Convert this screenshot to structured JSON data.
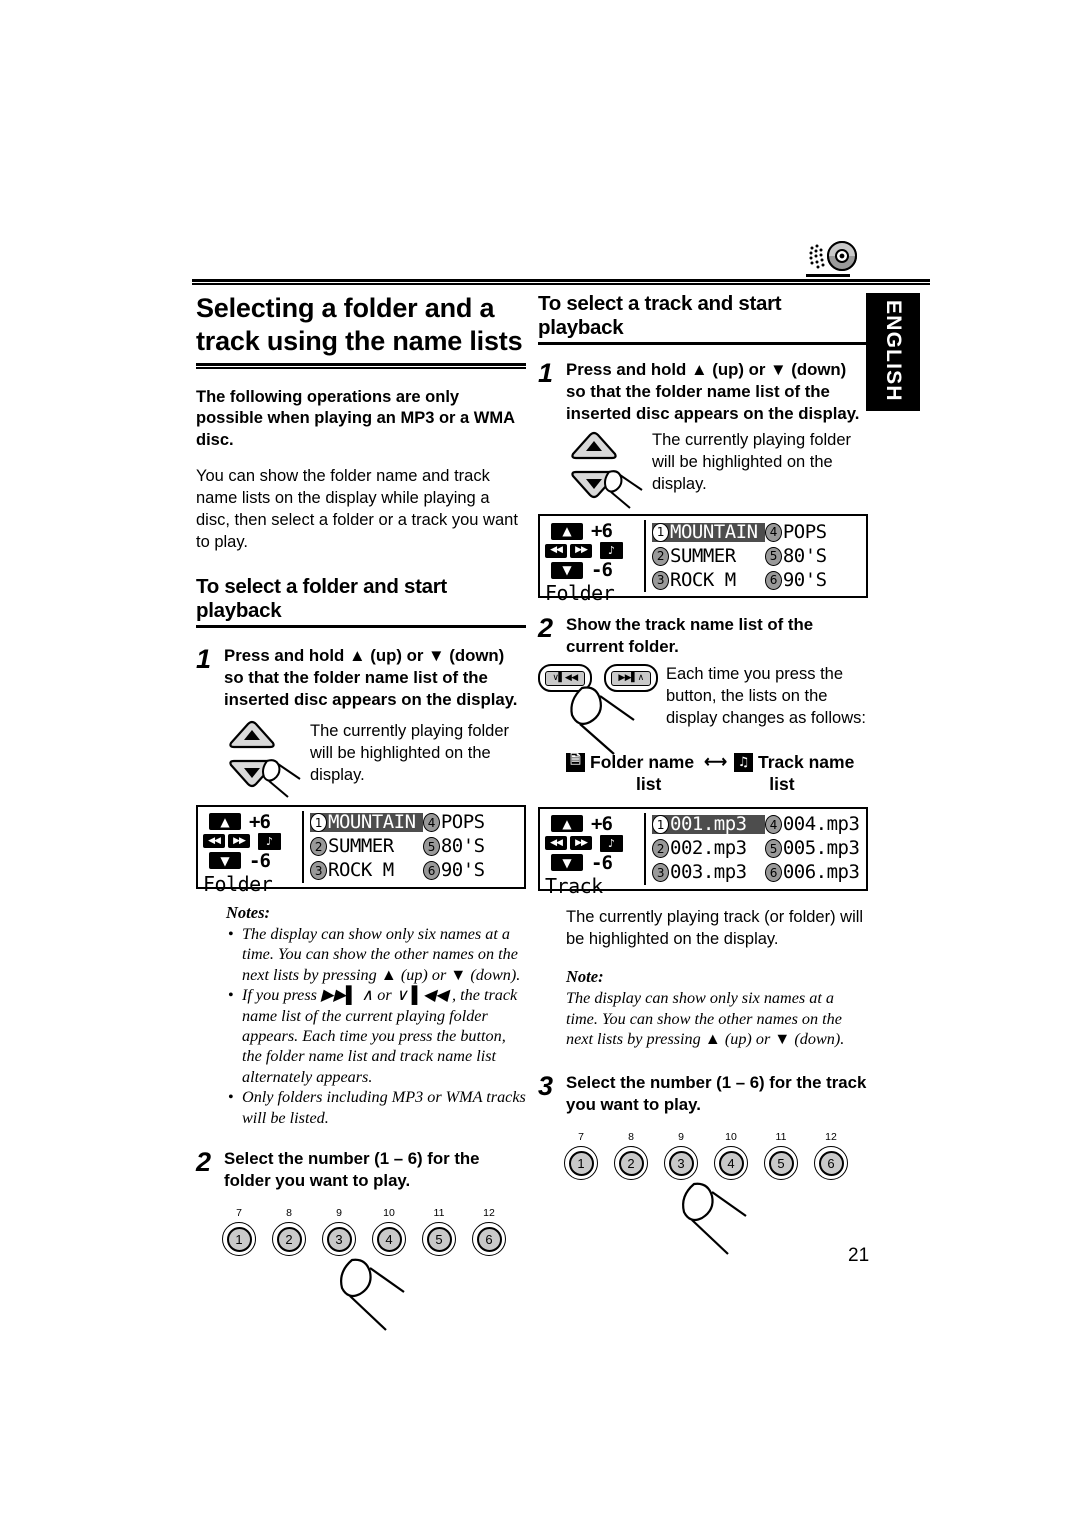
{
  "page": {
    "number": "21",
    "language_tab": "ENGLISH",
    "disc_icon": "compact-disc-icon"
  },
  "left_column": {
    "main_title": "Selecting a folder and a track using the name lists",
    "bold_lead": "The following operations are only possible when playing an MP3 or a WMA disc.",
    "intro_body": "You can show the folder name and track name lists on the display while playing a disc, then select a folder or a track you want to play.",
    "section_title": "To select a folder and start playback",
    "step1": {
      "number": "1",
      "text": "Press and hold ▲ (up) or ▼ (down) so that the folder name list of the inserted disc appears on the display.",
      "sub_note": "The currently playing folder will be highlighted on the display.",
      "button_up": "up-triangle-button",
      "button_down": "down-triangle-button"
    },
    "notes_heading": "Notes:",
    "notes": [
      "The display can show only six names at a time. You can show the other names on the next lists by pressing ▲ (up) or ▼ (down).",
      "If you press ▶▶▌ ∧ or ∨ ▌◀◀ , the track name list of the current playing folder appears. Each time you press the button, the folder name list and track name list alternately appears.",
      "Only folders including MP3 or WMA tracks will be listed."
    ],
    "step2": {
      "number": "2",
      "text": "Select the number (1 – 6) for the folder you want to play."
    }
  },
  "right_column": {
    "section_title": "To select a track and start playback",
    "step1": {
      "number": "1",
      "text": "Press and hold ▲ (up) or ▼ (down)  so that the folder name list of the inserted disc appears on the display.",
      "sub_note": "The currently playing folder will be highlighted on the display."
    },
    "step2": {
      "number": "2",
      "text": "Show the track name list of the current folder.",
      "sub_note": "Each time you press the button, the lists on the display changes as follows:",
      "button_left": "∨▌◀◀",
      "button_right": "▶▶▌∧",
      "folder_label_line1": "Folder name",
      "folder_label_line2": "list",
      "track_label_line1": "Track name",
      "track_label_line2": "list",
      "arrow": "←→"
    },
    "after_track_lcd_note": "The currently playing track (or folder) will be highlighted on the display.",
    "note_heading": "Note:",
    "note_body": "The display can show only six names at a time. You can show the other names on the next lists by pressing ▲ (up) or ▼ (down).",
    "step3": {
      "number": "3",
      "text": "Select the number (1 – 6) for the track you want to play."
    }
  },
  "lcd_folder": {
    "mode_label": "Folder",
    "level_up": "+6",
    "level_down": "-6",
    "skip_prev": "◀◀",
    "skip_next": "▶▶",
    "folder_track_icon": "folder-note-icon",
    "entries": [
      {
        "num": "1",
        "name": "MOUNTAIN",
        "highlighted": true
      },
      {
        "num": "4",
        "name": "POPS",
        "highlighted": false
      },
      {
        "num": "2",
        "name": "SUMMER",
        "highlighted": false
      },
      {
        "num": "5",
        "name": "80'S",
        "highlighted": false
      },
      {
        "num": "3",
        "name": "ROCK M",
        "highlighted": false
      },
      {
        "num": "6",
        "name": "90'S",
        "highlighted": false
      }
    ]
  },
  "lcd_track": {
    "mode_label": "Track",
    "level_up": "+6",
    "level_down": "-6",
    "entries": [
      {
        "num": "1",
        "name": "001.mp3",
        "highlighted": true
      },
      {
        "num": "4",
        "name": "004.mp3",
        "highlighted": false
      },
      {
        "num": "2",
        "name": "002.mp3",
        "highlighted": false
      },
      {
        "num": "5",
        "name": "005.mp3",
        "highlighted": false
      },
      {
        "num": "3",
        "name": "003.mp3",
        "highlighted": false
      },
      {
        "num": "6",
        "name": "006.mp3",
        "highlighted": false
      }
    ]
  },
  "number_buttons": {
    "top_labels": [
      "7",
      "8",
      "9",
      "10",
      "11",
      "12"
    ],
    "bottom_labels": [
      "1",
      "2",
      "3",
      "4",
      "5",
      "6"
    ]
  }
}
